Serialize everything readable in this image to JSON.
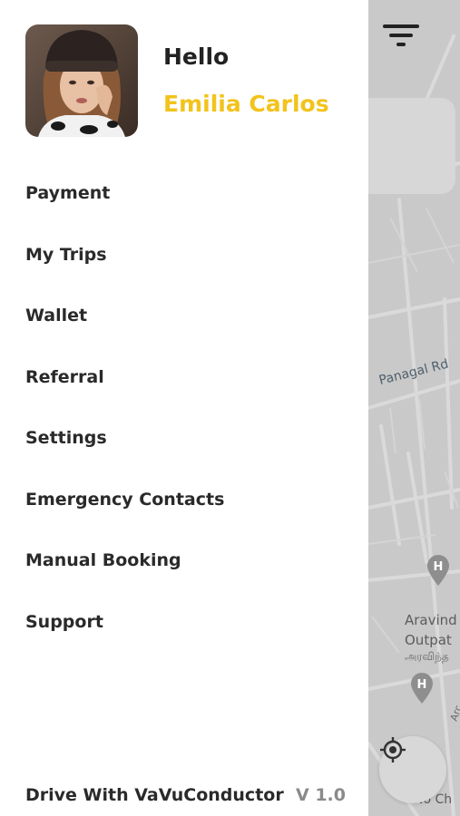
{
  "user": {
    "greeting": "Hello",
    "name": "Emilia Carlos"
  },
  "menu": {
    "items": [
      {
        "label": "Payment"
      },
      {
        "label": "My Trips"
      },
      {
        "label": "Wallet"
      },
      {
        "label": "Referral"
      },
      {
        "label": "Settings"
      },
      {
        "label": "Emergency Contacts"
      },
      {
        "label": "Manual Booking"
      },
      {
        "label": "Support"
      }
    ]
  },
  "footer": {
    "drive_label": "Drive With VaVuConductor",
    "version": "V 1.0"
  },
  "map": {
    "road_label": "Panagal Rd",
    "poi_name_line1": "Aravind",
    "poi_name_line2": "Outpat",
    "poi_name_tamil": "அரவிந்த",
    "cutoff_road": "Arc",
    "cutoff_bottom": "No Ch"
  },
  "icons": {
    "filter": "filter-icon",
    "car": "car-icon",
    "locate": "crosshair-icon",
    "hospital_marker": "hospital-marker-icon"
  },
  "colors": {
    "accent": "#f2c31c",
    "text": "#2a2a2a",
    "map_bg": "#c9c9c9"
  }
}
